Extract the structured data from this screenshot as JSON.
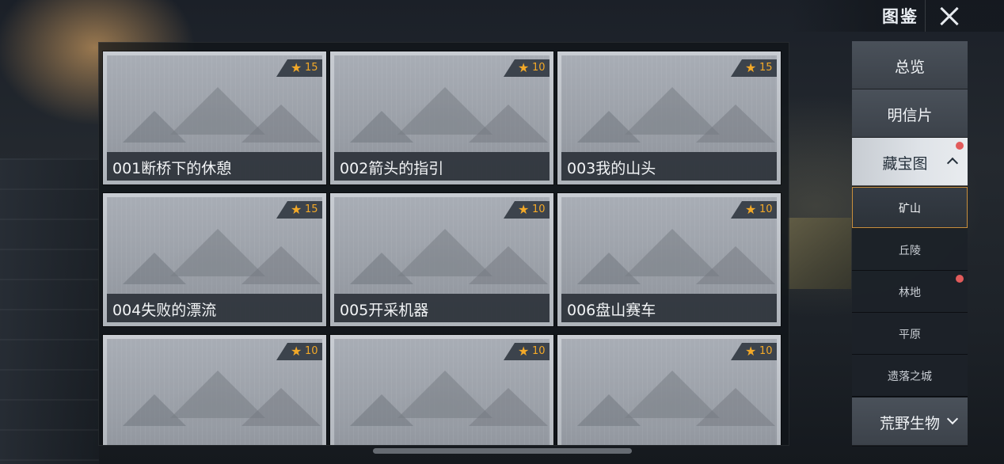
{
  "header": {
    "title": "图鉴"
  },
  "cards": [
    {
      "label": "001断桥下的休憩",
      "stars": "15"
    },
    {
      "label": "002箭头的指引",
      "stars": "10"
    },
    {
      "label": "003我的山头",
      "stars": "15"
    },
    {
      "label": "004失败的漂流",
      "stars": "15"
    },
    {
      "label": "005开采机器",
      "stars": "10"
    },
    {
      "label": "006盘山赛车",
      "stars": "10"
    },
    {
      "label": "",
      "stars": "10"
    },
    {
      "label": "",
      "stars": "10"
    },
    {
      "label": "",
      "stars": "10"
    }
  ],
  "sidebar": {
    "overview": "总览",
    "postcards": "明信片",
    "treasure_map": "藏宝图",
    "sub_items": [
      "矿山",
      "丘陵",
      "林地",
      "平原",
      "遗落之城"
    ],
    "wildlife": "荒野生物"
  },
  "colors": {
    "accent_star": "#f3a928",
    "notify_dot": "#e25b5b",
    "selected_border": "#c98f3c"
  }
}
